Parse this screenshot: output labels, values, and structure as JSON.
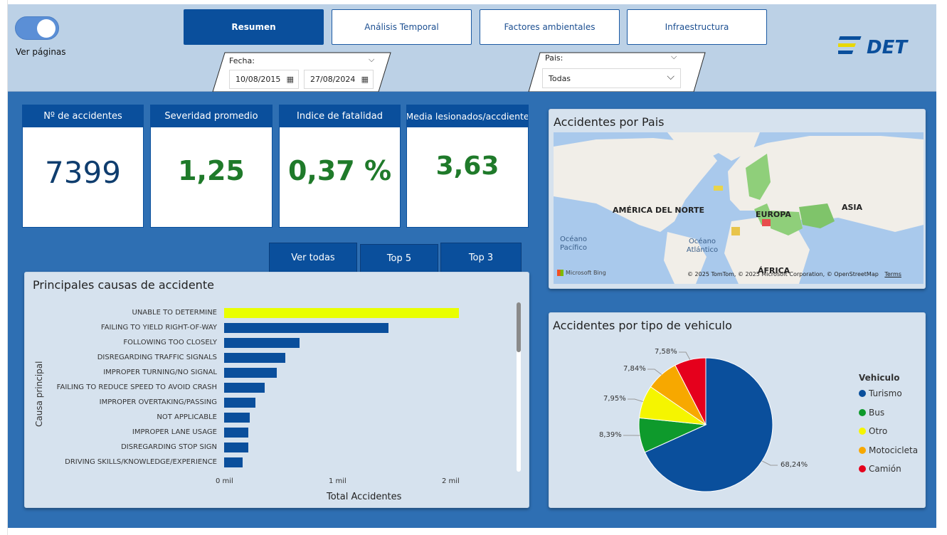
{
  "toggle": {
    "label": "Ver páginas"
  },
  "nav": [
    {
      "label": "Resumen",
      "active": true
    },
    {
      "label": "Análisis Temporal",
      "active": false
    },
    {
      "label": "Factores ambientales",
      "active": false
    },
    {
      "label": "Infraestructura",
      "active": false
    }
  ],
  "date_slicer": {
    "label": "Fecha:",
    "start": "10/08/2015",
    "end": "27/08/2024"
  },
  "country_slicer": {
    "label": "Pais:",
    "value": "Todas"
  },
  "logo": {
    "text": "DET"
  },
  "kpis": [
    {
      "title": "Nº de accidentes",
      "value": "7399"
    },
    {
      "title": "Severidad promedio",
      "value": "1,25"
    },
    {
      "title": "Indice de fatalidad",
      "value": "0,37 %"
    },
    {
      "title": "Media lesionados/accdiente",
      "value": "3,63"
    }
  ],
  "tabs": [
    {
      "label": "Ver todas"
    },
    {
      "label": "Top 5"
    },
    {
      "label": "Top 3"
    }
  ],
  "causes_chart": {
    "title": "Principales causas de accidente",
    "chart_data": {
      "type": "bar",
      "orientation": "horizontal",
      "title": "Principales causas de accidente",
      "xlabel": "Total Accidentes",
      "ylabel": "Causa principal",
      "xlim": [
        0,
        2200
      ],
      "xticks": [
        "0 mil",
        "1 mil",
        "2 mil"
      ],
      "categories": [
        "UNABLE TO DETERMINE",
        "FAILING TO YIELD RIGHT-OF-WAY",
        "FOLLOWING TOO CLOSELY",
        "DISREGARDING TRAFFIC SIGNALS",
        "IMPROPER TURNING/NO SIGNAL",
        "FAILING TO REDUCE SPEED TO AVOID CRASH",
        "IMPROPER OVERTAKING/PASSING",
        "NOT APPLICABLE",
        "IMPROPER LANE USAGE",
        "DISREGARDING STOP SIGN",
        "DRIVING SKILLS/KNOWLEDGE/EXPERIENCE"
      ],
      "values": [
        2080,
        1460,
        670,
        545,
        470,
        360,
        275,
        225,
        215,
        215,
        165
      ],
      "highlight_color": "#e9ff00",
      "bar_color": "#0a4f9c"
    }
  },
  "map_panel": {
    "title": "Accidentes por Pais",
    "labels": {
      "north_america": "AMÉRICA DEL NORTE",
      "europe": "EUROPA",
      "asia": "ASIA",
      "africa": "ÁFRICA",
      "pacific": "Océano Pacífico",
      "atlantic": "Océano Atlántico",
      "bing": "Microsoft Bing",
      "attribution": "© 2025 TomTom, © 2025 Microsoft Corporation, © OpenStreetMap",
      "terms": "Terms"
    }
  },
  "vehicle_chart": {
    "title": "Accidentes por tipo de vehiculo",
    "legend_title": "Vehiculo",
    "chart_data": {
      "type": "pie",
      "title": "Accidentes por tipo de vehiculo",
      "legend_title": "Vehiculo",
      "legend_position": "right",
      "slices": [
        {
          "name": "Turismo",
          "value": 68.24,
          "label": "68,24%",
          "color": "#0a4f9c"
        },
        {
          "name": "Bus",
          "value": 8.39,
          "label": "8,39%",
          "color": "#0e9a2c"
        },
        {
          "name": "Otro",
          "value": 7.95,
          "label": "7,95%",
          "color": "#f5f500"
        },
        {
          "name": "Motocicleta",
          "value": 7.84,
          "label": "7,84%",
          "color": "#f7a800"
        },
        {
          "name": "Camión",
          "value": 7.58,
          "label": "7,58%",
          "color": "#e5001c"
        }
      ]
    }
  }
}
